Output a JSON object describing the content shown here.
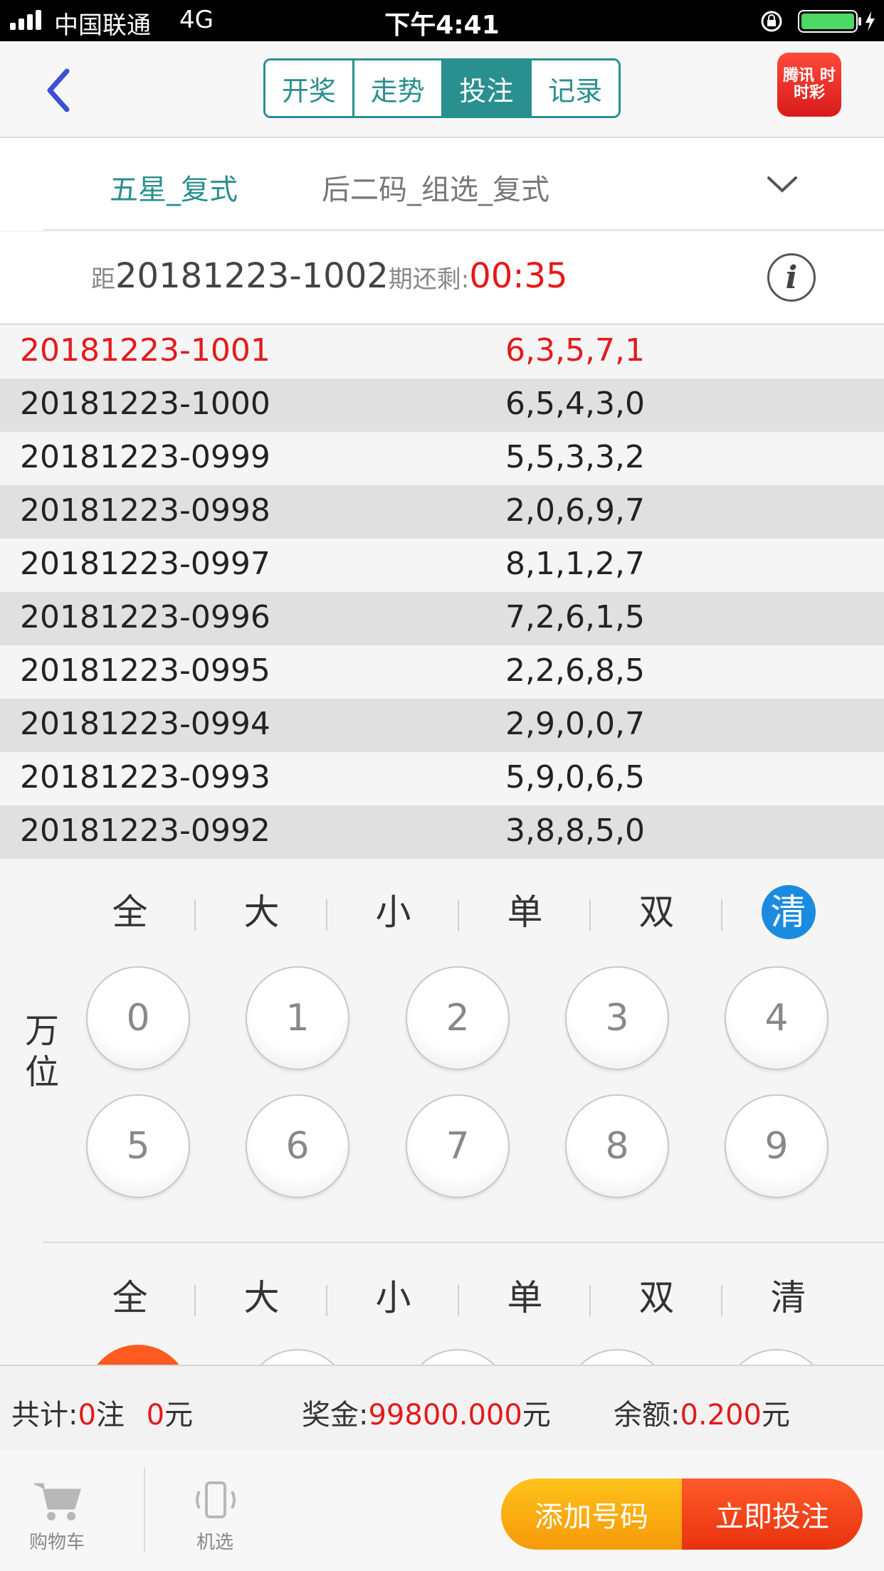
{
  "status_bar": {
    "carrier": "中国联通",
    "network": "4G",
    "time": "下午4:41"
  },
  "nav": {
    "tabs": [
      {
        "label": "开奖",
        "active": false
      },
      {
        "label": "走势",
        "active": false
      },
      {
        "label": "投注",
        "active": true
      },
      {
        "label": "记录",
        "active": false
      }
    ],
    "logo_text": "腾讯 时时彩"
  },
  "play": {
    "primary": "五星_复式",
    "secondary": "后二码_组选_复式"
  },
  "countdown": {
    "prefix": "距",
    "issue": "20181223-1002",
    "middle": "期还剩:",
    "remaining": "00:35"
  },
  "history": [
    {
      "issue": "20181223-1001",
      "numbers": "6,3,5,7,1"
    },
    {
      "issue": "20181223-1000",
      "numbers": "6,5,4,3,0"
    },
    {
      "issue": "20181223-0999",
      "numbers": "5,5,3,3,2"
    },
    {
      "issue": "20181223-0998",
      "numbers": "2,0,6,9,7"
    },
    {
      "issue": "20181223-0997",
      "numbers": "8,1,1,2,7"
    },
    {
      "issue": "20181223-0996",
      "numbers": "7,2,6,1,5"
    },
    {
      "issue": "20181223-0995",
      "numbers": "2,2,6,8,5"
    },
    {
      "issue": "20181223-0994",
      "numbers": "2,9,0,0,7"
    },
    {
      "issue": "20181223-0993",
      "numbers": "5,9,0,6,5"
    },
    {
      "issue": "20181223-0992",
      "numbers": "3,8,8,5,0"
    }
  ],
  "picker": {
    "filters": [
      "全",
      "大",
      "小",
      "单",
      "双",
      "清"
    ],
    "position_label": "万位",
    "balls": [
      "0",
      "1",
      "2",
      "3",
      "4",
      "5",
      "6",
      "7",
      "8",
      "9"
    ]
  },
  "summary": {
    "count_label": "共计:",
    "count": "0",
    "count_unit": "注",
    "amount": "0",
    "amount_unit": "元",
    "prize_label": "奖金:",
    "prize": "99800.000",
    "prize_unit": "元",
    "balance_label": "余额:",
    "balance": "0.200",
    "balance_unit": "元"
  },
  "bottom": {
    "cart_label": "购物车",
    "random_label": "机选",
    "add_button": "添加号码",
    "bet_button": "立即投注"
  },
  "colors": {
    "teal": "#2a8f8f",
    "red": "#e41a1a",
    "blue": "#1b8be0",
    "orange": "#f59a0a"
  }
}
